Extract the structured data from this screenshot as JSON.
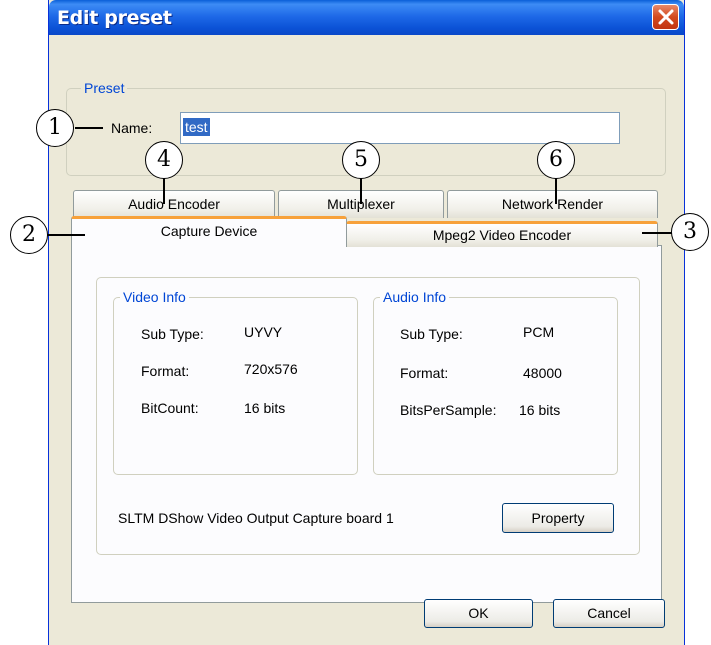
{
  "window": {
    "title": "Edit preset"
  },
  "preset": {
    "legend": "Preset",
    "name_label": "Name:",
    "name_value": "test"
  },
  "tabs": {
    "row_back": [
      "Audio Encoder",
      "Multiplexer",
      "Network Render"
    ],
    "row_front": [
      "Capture Device",
      "Mpeg2 Video Encoder"
    ]
  },
  "video_info": {
    "legend": "Video Info",
    "rows": [
      {
        "label": "Sub Type:",
        "value": "UYVY"
      },
      {
        "label": "Format:",
        "value": "720x576"
      },
      {
        "label": "BitCount:",
        "value": "16 bits"
      }
    ]
  },
  "audio_info": {
    "legend": "Audio Info",
    "rows": [
      {
        "label": "Sub Type:",
        "value": "PCM"
      },
      {
        "label": "Format:",
        "value": "48000"
      },
      {
        "label": "BitsPerSample:",
        "value": "16 bits"
      }
    ]
  },
  "device_name": "SLTM DShow  Video Output Capture board 1",
  "buttons": {
    "property": "Property",
    "ok": "OK",
    "cancel": "Cancel"
  },
  "callouts": [
    "1",
    "2",
    "3",
    "4",
    "5",
    "6"
  ]
}
